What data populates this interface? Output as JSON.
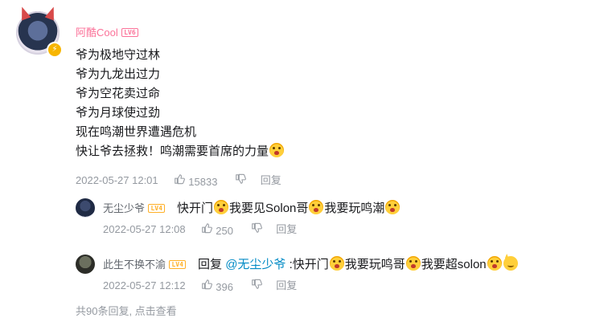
{
  "main_comment": {
    "username": "阿酷Cool",
    "level": "LV6",
    "lines": [
      "爷为极地守过林",
      "爷为九龙出过力",
      "爷为空花卖过命",
      "爷为月球使过劲",
      "现在鸣潮世界遭遇危机",
      "快让爷去拯救！鸣潮需要首席的力量"
    ],
    "timestamp": "2022-05-27 12:01",
    "likes": "15833",
    "reply_label": "回复"
  },
  "replies": [
    {
      "username": "无尘少爷",
      "level": "LV4",
      "parts": [
        "快开门",
        "我要见Solon哥",
        "我要玩鸣潮"
      ],
      "timestamp": "2022-05-27 12:08",
      "likes": "250",
      "reply_label": "回复"
    },
    {
      "username": "此生不换不渝",
      "level": "LV4",
      "prefix": "回复",
      "mention": "@无尘少爷",
      "parts": [
        ":快开门",
        "我要玩鸣哥",
        "我要超solon"
      ],
      "timestamp": "2022-05-27 12:12",
      "likes": "396",
      "reply_label": "回复"
    }
  ],
  "footer": {
    "text": "共90条回复, 点击查看"
  },
  "icons": {
    "like": "thumbs-up-icon",
    "dislike": "thumbs-down-icon",
    "emoji_primary": "shocked-face-emoji",
    "emoji_secondary": "cat-face-emoji"
  },
  "colors": {
    "vip_name": "#fb7299",
    "mention": "#008ac5",
    "meta": "#9499a0"
  }
}
